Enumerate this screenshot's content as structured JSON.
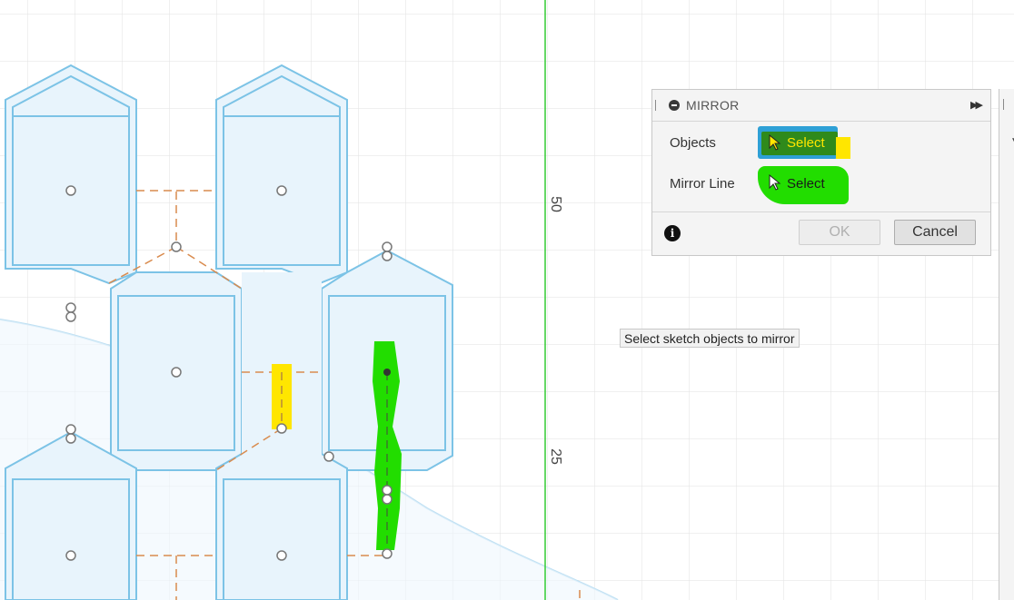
{
  "dialog": {
    "title": "MIRROR",
    "rows": [
      {
        "label": "Objects",
        "button": "Select"
      },
      {
        "label": "Mirror Line",
        "button": "Select"
      }
    ],
    "ok_label": "OK",
    "cancel_label": "Cancel"
  },
  "tooltip": "Select sketch objects to mirror",
  "ruler": {
    "mark_50": "50",
    "mark_25": "25"
  },
  "colors": {
    "sketch_blue": "#7cc3e6",
    "profile_fill": "#e8f4fc",
    "construction_orange": "#d98b4e",
    "axis_green": "#33cc33",
    "highlight_yellow": "#ffe600",
    "highlight_green": "#22dd00",
    "select_blue": "#2ea0d6"
  },
  "icons": [
    "minus-circle-icon",
    "expand-icon",
    "cursor-arrow-icon",
    "info-icon"
  ]
}
